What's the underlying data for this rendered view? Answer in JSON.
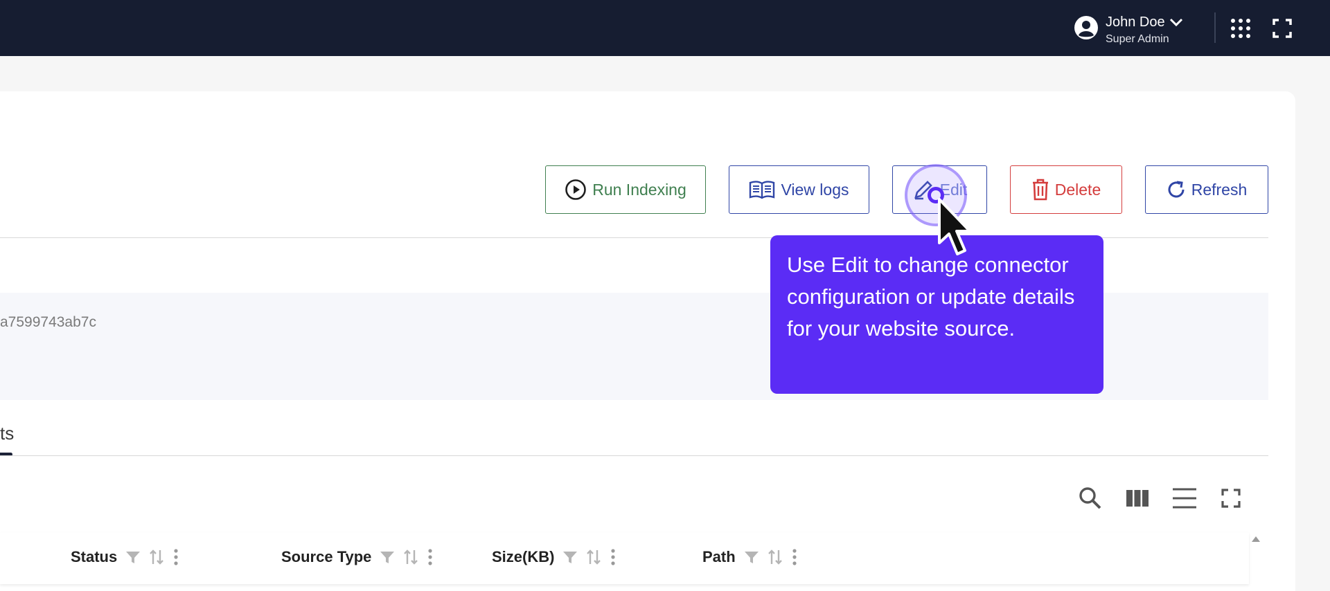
{
  "header": {
    "user_name": "John Doe",
    "user_role": "Super Admin",
    "icons": [
      "user-avatar-icon",
      "chevron-down-icon",
      "apps-grid-icon",
      "fullscreen-icon"
    ]
  },
  "actions": {
    "run_indexing": "Run Indexing",
    "view_logs": "View logs",
    "edit": "Edit",
    "delete": "Delete",
    "refresh": "Refresh"
  },
  "details": {
    "id_fragment": "a7599743ab7c"
  },
  "tab": {
    "label": "ts"
  },
  "table": {
    "columns": [
      "Status",
      "Source Type",
      "Size(KB)",
      "Path"
    ],
    "toolbar_icons": [
      "search-icon",
      "columns-icon",
      "density-icon",
      "fullscreen-icon"
    ]
  },
  "tooltip": {
    "text": "Use Edit to change connector configuration or update details for your website source."
  },
  "colors": {
    "topbar": "#161d31",
    "tooltip": "#5b2cf5",
    "run_green": "#3f7f4f",
    "primary_blue": "#2f45a6",
    "danger_red": "#d43c3c"
  }
}
